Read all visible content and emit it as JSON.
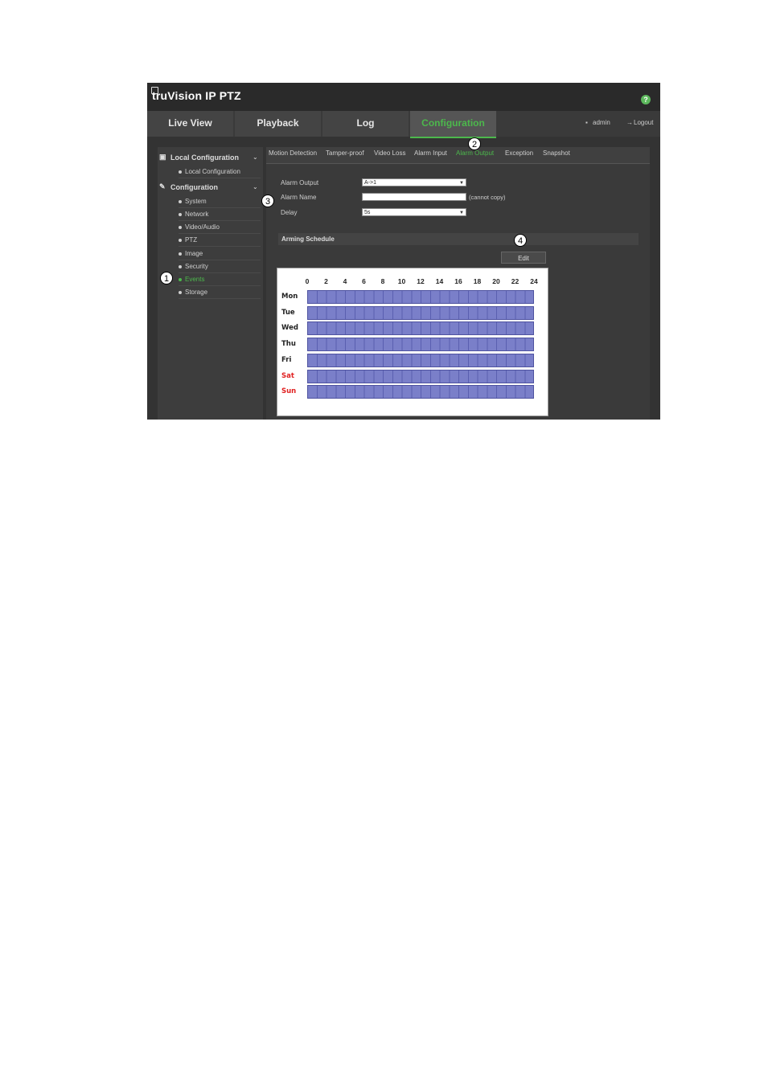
{
  "app": {
    "title": "truVision  IP PTZ"
  },
  "nav": {
    "items": [
      "Live View",
      "Playback",
      "Log",
      "Configuration"
    ],
    "active": "Configuration",
    "user": "admin",
    "logout": "Logout"
  },
  "sidebar": {
    "local_header": "Local Configuration",
    "local_items": [
      "Local Configuration"
    ],
    "config_header": "Configuration",
    "config_items": [
      "System",
      "Network",
      "Video/Audio",
      "PTZ",
      "Image",
      "Security",
      "Events",
      "Storage"
    ],
    "active": "Events"
  },
  "tabs": {
    "items": [
      "Motion Detection",
      "Tamper-proof",
      "Video Loss",
      "Alarm Input",
      "Alarm Output",
      "Exception",
      "Snapshot"
    ],
    "active": "Alarm Output"
  },
  "form": {
    "alarm_output_label": "Alarm Output",
    "alarm_output_value": "A->1",
    "alarm_name_label": "Alarm Name",
    "alarm_name_value": "",
    "alarm_name_hint": "(cannot copy)",
    "delay_label": "Delay",
    "delay_value": "5s"
  },
  "schedule": {
    "title": "Arming Schedule",
    "edit_label": "Edit",
    "hours": [
      "0",
      "2",
      "4",
      "6",
      "8",
      "10",
      "12",
      "14",
      "16",
      "18",
      "20",
      "22",
      "24"
    ],
    "days": [
      "Mon",
      "Tue",
      "Wed",
      "Thu",
      "Fri",
      "Sat",
      "Sun"
    ],
    "weekend_color": "#e02020",
    "weekday_color": "#222222",
    "armed_color": "#7a7fc9"
  },
  "callouts": [
    "1",
    "2",
    "3",
    "4"
  ],
  "colors": {
    "accent": "#4cb84c",
    "background": "#333333"
  }
}
